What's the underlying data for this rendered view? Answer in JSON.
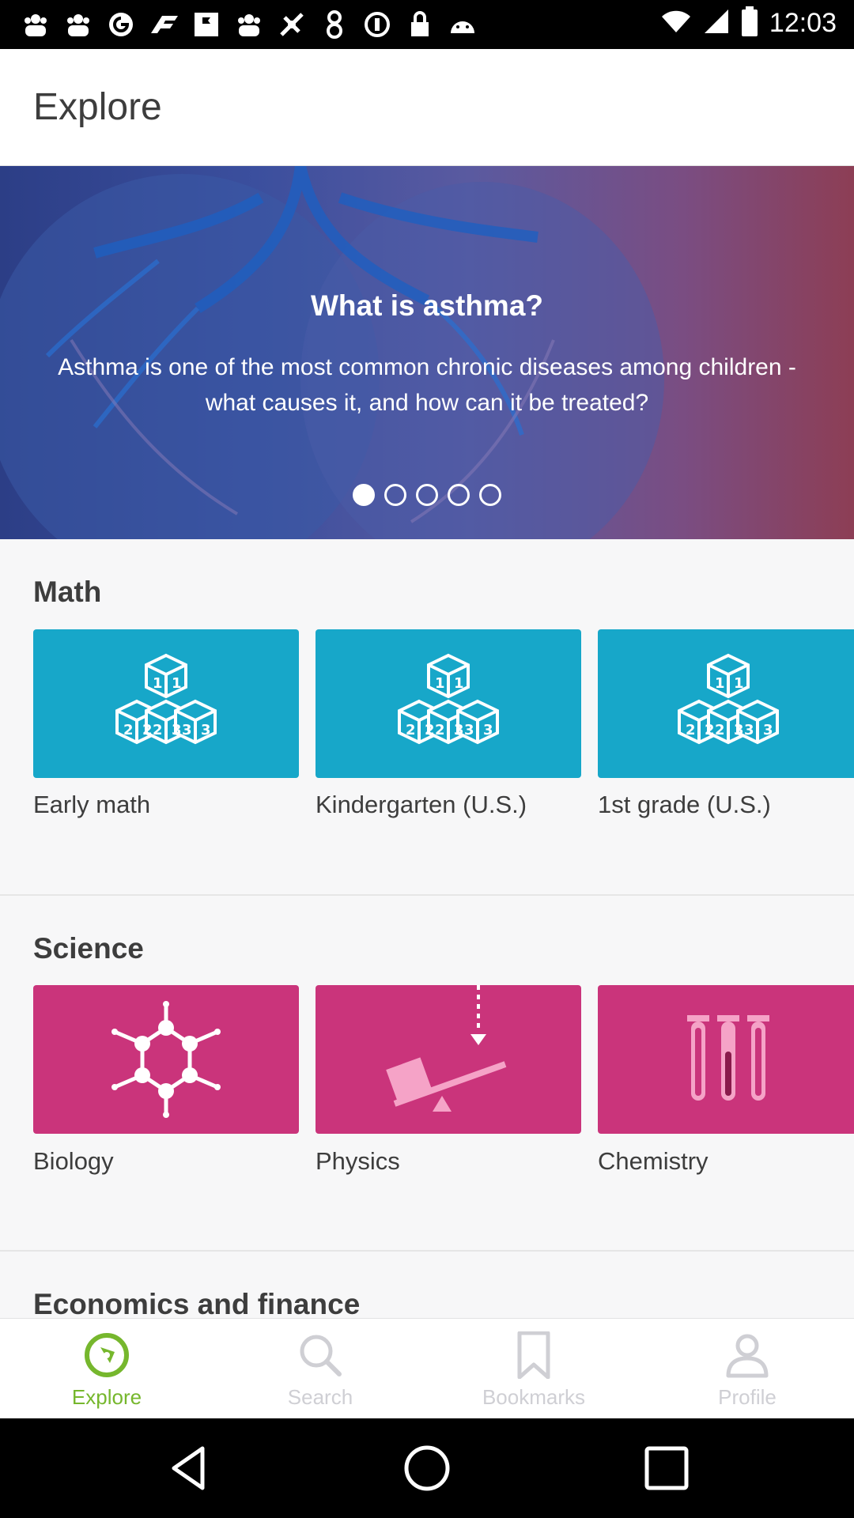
{
  "status_bar": {
    "time": "12:03",
    "left_icons": [
      "app-icon",
      "app-icon",
      "cloud-g-icon",
      "racing-icon",
      "flag-icon",
      "app-icon",
      "fake-gps-icon",
      "person-icon",
      "circle-icon",
      "lock-icon",
      "android-icon"
    ],
    "right_icons": [
      "wifi-icon",
      "signal-icon",
      "battery-icon"
    ]
  },
  "header": {
    "title": "Explore"
  },
  "hero": {
    "title": "What is asthma?",
    "description": "Asthma is one of the most common chronic diseases among children - what causes it, and how can it be treated?",
    "pager": {
      "count": 5,
      "active_index": 0
    }
  },
  "sections": {
    "math": {
      "title": "Math",
      "color": "#17a7c9",
      "items": [
        {
          "label": "Early math",
          "icon": "blocks-icon"
        },
        {
          "label": "Kindergarten (U.S.)",
          "icon": "blocks-icon"
        },
        {
          "label": "1st grade (U.S.)",
          "icon": "blocks-icon"
        }
      ]
    },
    "science": {
      "title": "Science",
      "color": "#ca347b",
      "items": [
        {
          "label": "Biology",
          "icon": "molecule-icon"
        },
        {
          "label": "Physics",
          "icon": "seesaw-icon"
        },
        {
          "label": "Chemistry",
          "icon": "test-tubes-icon"
        }
      ]
    },
    "economics": {
      "title": "Economics and finance"
    }
  },
  "bottom_nav": {
    "active_color": "#76b72d",
    "items": [
      {
        "label": "Explore",
        "icon": "compass-icon",
        "active": true
      },
      {
        "label": "Search",
        "icon": "search-icon",
        "active": false
      },
      {
        "label": "Bookmarks",
        "icon": "bookmark-icon",
        "active": false
      },
      {
        "label": "Profile",
        "icon": "profile-icon",
        "active": false
      }
    ]
  }
}
